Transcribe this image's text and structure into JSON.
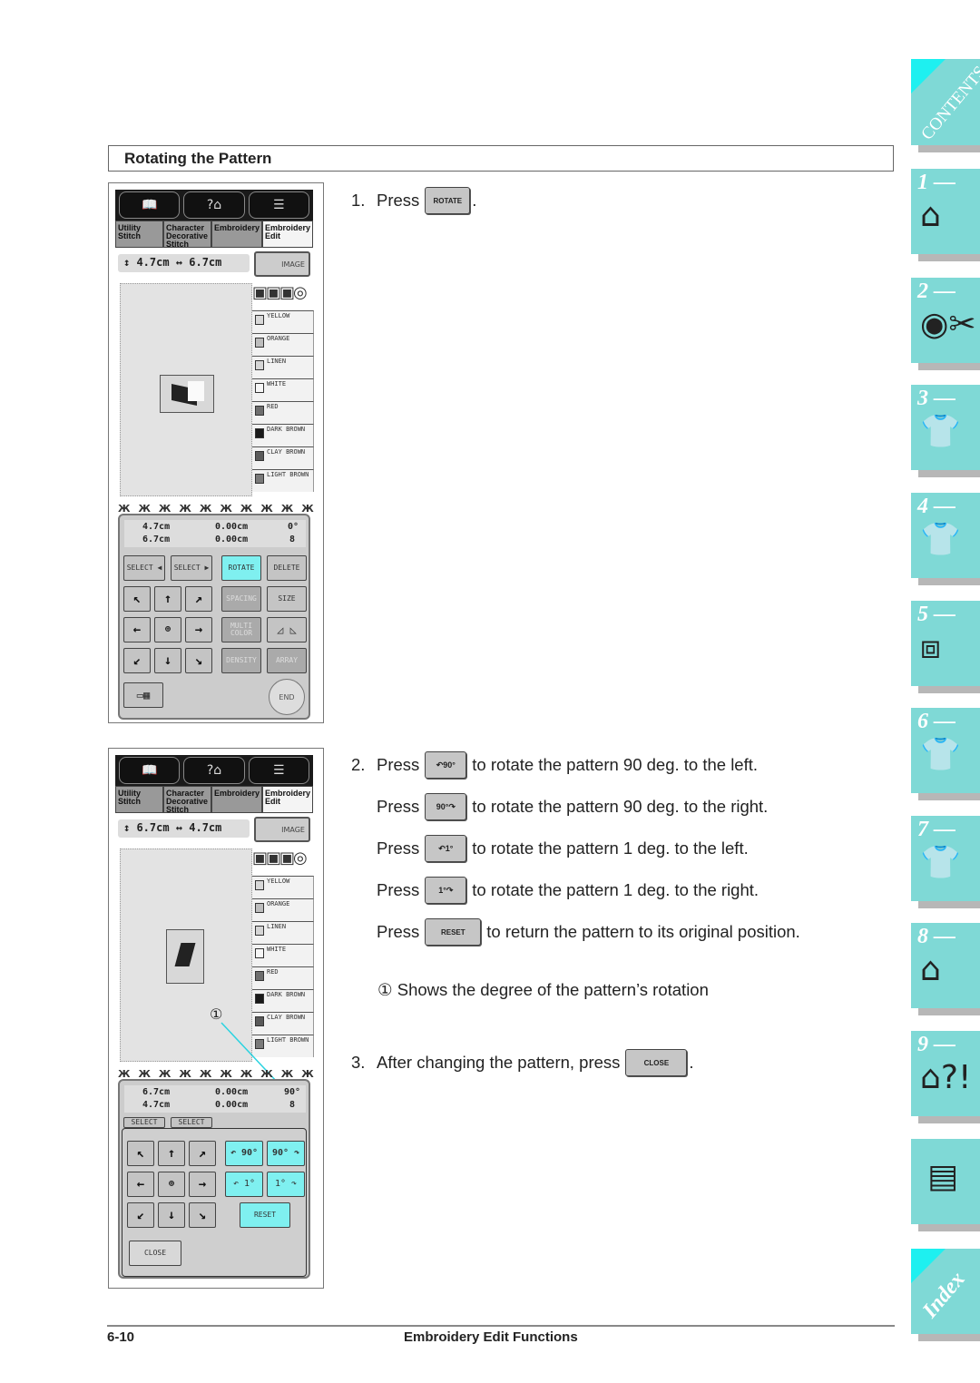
{
  "section": {
    "title": "Rotating the Pattern"
  },
  "screen1": {
    "tabs": [
      "Utility Stitch",
      "Character Decorative Stitch",
      "Embroidery",
      "Embroidery Edit"
    ],
    "size_bar": "↕ 4.7cm ↔ 6.7cm",
    "image_button": "IMAGE",
    "colors": [
      {
        "name": "YELLOW",
        "swatch": "#d8d8d8"
      },
      {
        "name": "ORANGE",
        "swatch": "#bdbdbd"
      },
      {
        "name": "LINEN",
        "swatch": "#d5d5d5"
      },
      {
        "name": "WHITE",
        "swatch": "#f6f6f6"
      },
      {
        "name": "RED",
        "swatch": "#6e6e6e"
      },
      {
        "name": "DARK BROWN",
        "swatch": "#1a1a1a"
      },
      {
        "name": "CLAY BROWN",
        "swatch": "#5a5a5a"
      },
      {
        "name": "LIGHT BROWN",
        "swatch": "#7a7a7a"
      }
    ],
    "readout": {
      "height": "4.7cm",
      "width": "6.7cm",
      "vpos": "0.00cm",
      "hpos": "0.00cm",
      "rotation": "0°",
      "colors": "8"
    },
    "buttons": {
      "select_left": "SELECT ◀",
      "select_right": "SELECT ▶",
      "rotate": "ROTATE",
      "delete": "DELETE",
      "spacing": "SPACING",
      "size": "SIZE",
      "multicolor": "MULTI COLOR",
      "mirror": "◿ ◺",
      "density": "DENSITY",
      "array": "ARRAY",
      "end": "END"
    }
  },
  "screen2": {
    "tabs": [
      "Utility Stitch",
      "Character Decorative Stitch",
      "Embroidery",
      "Embroidery Edit"
    ],
    "size_bar": "↕ 6.7cm ↔ 4.7cm",
    "image_button": "IMAGE",
    "colors": [
      {
        "name": "YELLOW",
        "swatch": "#d8d8d8"
      },
      {
        "name": "ORANGE",
        "swatch": "#bdbdbd"
      },
      {
        "name": "LINEN",
        "swatch": "#d5d5d5"
      },
      {
        "name": "WHITE",
        "swatch": "#f6f6f6"
      },
      {
        "name": "RED",
        "swatch": "#6e6e6e"
      },
      {
        "name": "DARK BROWN",
        "swatch": "#1a1a1a"
      },
      {
        "name": "CLAY BROWN",
        "swatch": "#5a5a5a"
      },
      {
        "name": "LIGHT BROWN",
        "swatch": "#7a7a7a"
      }
    ],
    "readout": {
      "height": "6.7cm",
      "width": "4.7cm",
      "vpos": "0.00cm",
      "hpos": "0.00cm",
      "rotation": "90°",
      "colors": "8"
    },
    "callout": "①",
    "buttons": {
      "select_left": "SELECT",
      "select_right": "SELECT",
      "rot_left_90": "↶ 90°",
      "rot_right_90": "90° ↷",
      "rot_left_1": "↶ 1°",
      "rot_right_1": "1° ↷",
      "reset": "RESET",
      "close": "CLOSE"
    }
  },
  "steps": {
    "s1": {
      "num": "1.",
      "pre": "Press",
      "btn": "ROTATE",
      "post": "."
    },
    "s2": [
      {
        "num": "2.",
        "pre": "Press",
        "btn": "↶90°",
        "post": "to rotate the pattern 90 deg. to the left."
      },
      {
        "num": "",
        "pre": "Press",
        "btn": "90°↷",
        "post": "to rotate the pattern 90 deg. to the right."
      },
      {
        "num": "",
        "pre": "Press",
        "btn": "↶1°",
        "post": "to rotate the pattern 1 deg. to the left."
      },
      {
        "num": "",
        "pre": "Press",
        "btn": "1°↷",
        "post": "to rotate the pattern 1 deg. to the right."
      },
      {
        "num": "",
        "pre": "Press",
        "btn": "RESET",
        "post": "to return the pattern to its original position."
      }
    ],
    "note": "① Shows the degree of the pattern’s rotation",
    "s3": {
      "num": "3.",
      "pre": "After changing the pattern, press",
      "btn": "CLOSE",
      "post": "."
    }
  },
  "side_tabs": {
    "contents": "CONTENTS",
    "chapters": [
      "1 —",
      "2 —",
      "3 —",
      "4 —",
      "5 —",
      "6 —",
      "7 —",
      "8 —",
      "9 —"
    ],
    "index": "Index"
  },
  "footer": {
    "page": "6-10",
    "title": "Embroidery Edit Functions"
  }
}
